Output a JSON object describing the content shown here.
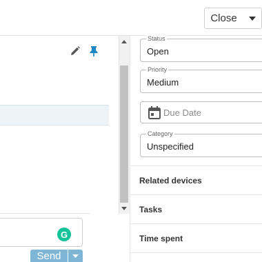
{
  "header": {
    "close_label": "Close"
  },
  "compose": {
    "send_label": "Send",
    "grammarly_letter": "G"
  },
  "fields": {
    "status": {
      "label": "Status",
      "value": "Open"
    },
    "priority": {
      "label": "Priority",
      "value": "Medium"
    },
    "due_date": {
      "placeholder": "Due Date"
    },
    "category": {
      "label": "Category",
      "value": "Unspecified"
    }
  },
  "sections": [
    {
      "label": "Related devices"
    },
    {
      "label": "Tasks"
    },
    {
      "label": "Time spent"
    }
  ],
  "icons": {
    "edit": "pencil-icon",
    "pin": "pin-icon",
    "calendar": "calendar-icon",
    "grammarly": "grammarly-icon"
  },
  "colors": {
    "accent": "#7fb6d6",
    "pin": "#1e88c7",
    "grammarly": "#15c39a",
    "highlight_row": "#edf3f7"
  }
}
